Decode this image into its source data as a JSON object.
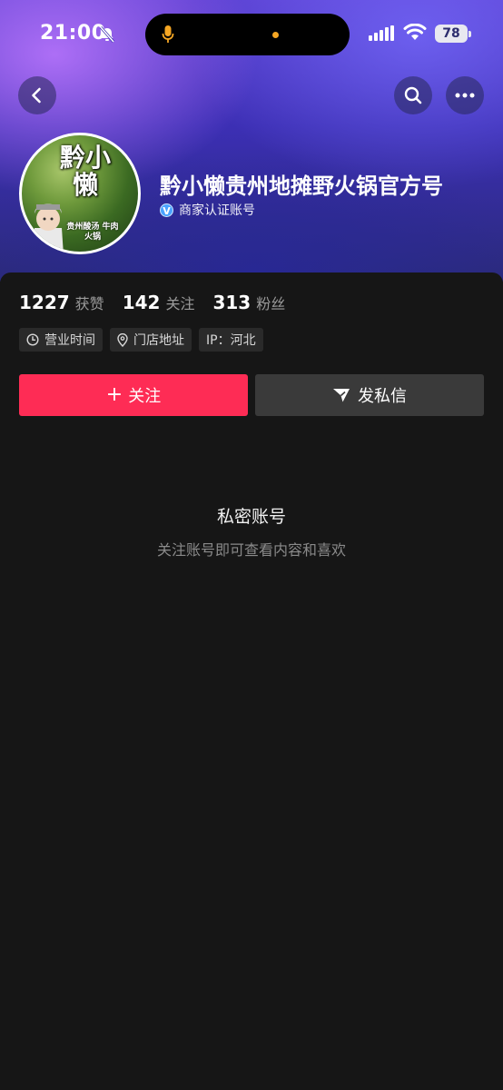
{
  "status_bar": {
    "time": "21:00",
    "battery": "78"
  },
  "profile": {
    "avatar_text": "黔小懒",
    "avatar_subtext": "贵州酸汤 牛肉火锅",
    "name": "黔小懒贵州地摊野火锅官方号",
    "verified_label": "商家认证账号"
  },
  "stats": [
    {
      "value": "1227",
      "label": "获赞"
    },
    {
      "value": "142",
      "label": "关注"
    },
    {
      "value": "313",
      "label": "粉丝"
    }
  ],
  "tags": [
    {
      "label": "营业时间",
      "icon": "clock-icon"
    },
    {
      "label": "门店地址",
      "icon": "location-pin-icon"
    },
    {
      "label": "IP：河北",
      "icon": ""
    }
  ],
  "actions": {
    "follow_label": "关注",
    "message_label": "发私信"
  },
  "private": {
    "title": "私密账号",
    "subtitle": "关注账号即可查看内容和喜欢"
  },
  "colors": {
    "accent": "#fe2c55",
    "background": "#161616",
    "verified": "#4aa3ff"
  }
}
